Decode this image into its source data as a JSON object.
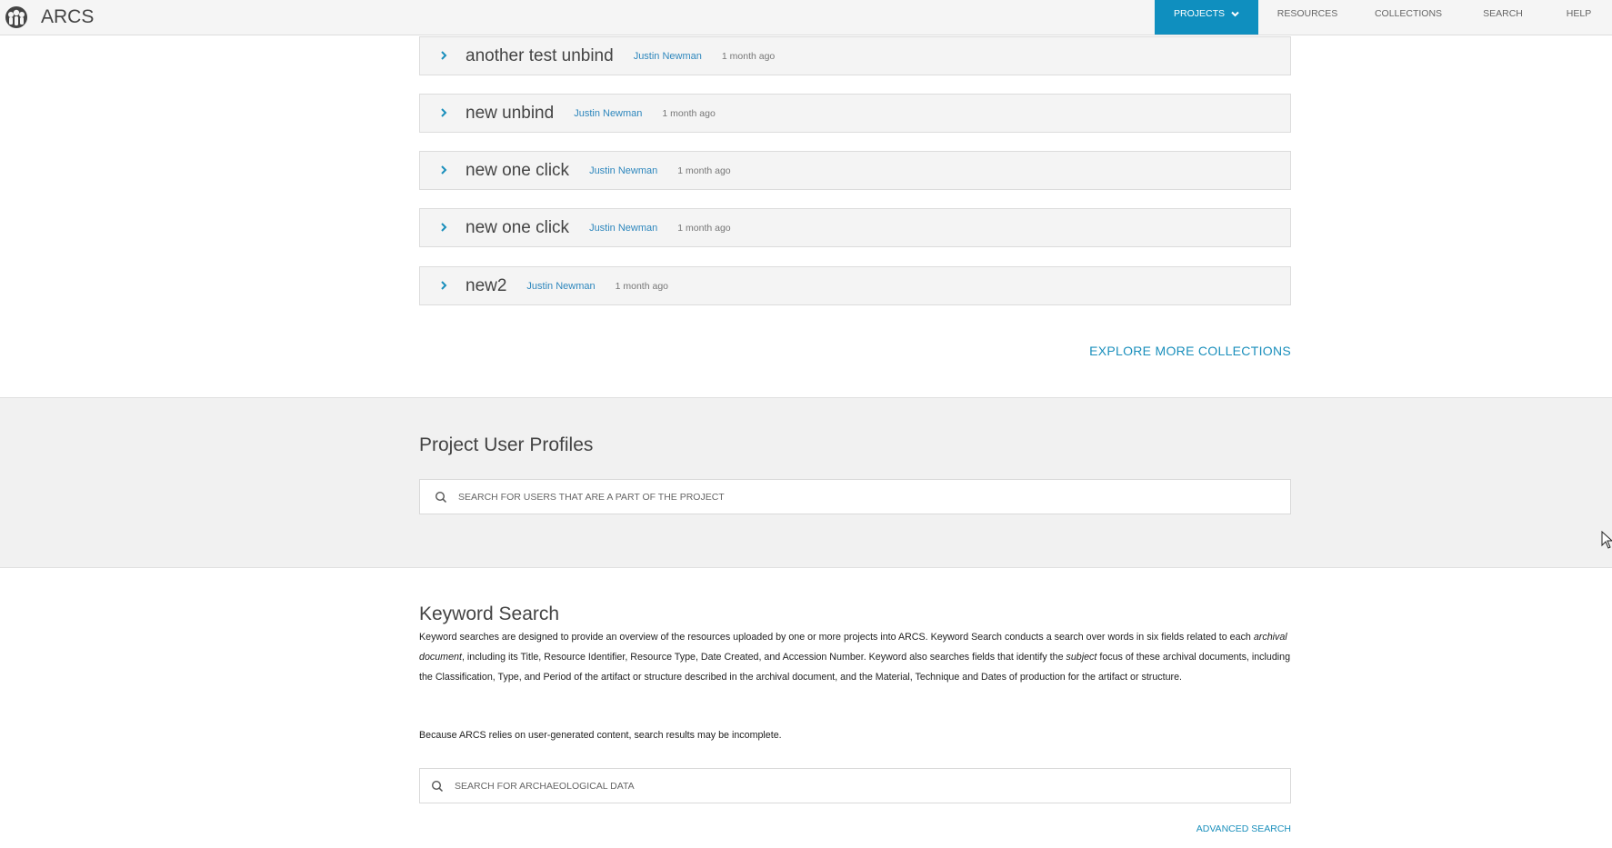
{
  "header": {
    "app_title": "ARCS",
    "logo_icon": "arcs-logo-icon",
    "nav": {
      "projects": "PROJECTS",
      "resources": "RESOURCES",
      "collections": "COLLECTIONS",
      "search": "SEARCH",
      "help": "HELP"
    },
    "accent_color": "#0f8fbf"
  },
  "collections": [
    {
      "title": "another test unbind",
      "author": "Justin Newman",
      "time": "1 month ago"
    },
    {
      "title": "new unbind",
      "author": "Justin Newman",
      "time": "1 month ago"
    },
    {
      "title": "new one click",
      "author": "Justin Newman",
      "time": "1 month ago"
    },
    {
      "title": "new one click",
      "author": "Justin Newman",
      "time": "1 month ago"
    },
    {
      "title": "new2",
      "author": "Justin Newman",
      "time": "1 month ago"
    }
  ],
  "explore_link": "EXPLORE MORE COLLECTIONS",
  "profiles": {
    "heading": "Project User Profiles",
    "search_placeholder": "SEARCH FOR USERS THAT ARE A PART OF THE PROJECT"
  },
  "keyword": {
    "heading": "Keyword Search",
    "p1_a": "Keyword searches are designed to provide an overview of the resources uploaded by one or more projects into ARCS. Keyword Search conducts a search over words in six fields related to each ",
    "p1_em1": "archival document",
    "p1_b": ", including its Title, Resource Identifier, Resource Type, Date Created, and Accession Number. Keyword also searches fields that identify the ",
    "p1_em2": "subject",
    "p1_c": " focus of these archival documents, including the Classification, Type, and Period of the artifact or structure described in the archival document, and the Material, Technique and Dates of production for the artifact or structure.",
    "note": "Because ARCS relies on user-generated content, search results may be incomplete.",
    "search_placeholder": "SEARCH FOR ARCHAEOLOGICAL DATA",
    "advanced_link": "ADVANCED SEARCH"
  }
}
